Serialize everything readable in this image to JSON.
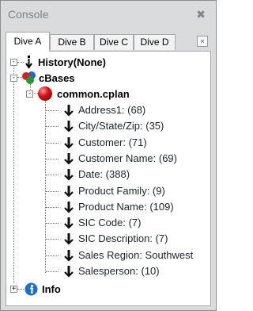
{
  "window": {
    "title": "Console",
    "close_glyph": "✖"
  },
  "tabs": [
    {
      "label": "Dive A",
      "active": true
    },
    {
      "label": "Dive B",
      "active": false
    },
    {
      "label": "Dive C",
      "active": false
    },
    {
      "label": "Dive D",
      "active": false
    }
  ],
  "tab_close_glyph": "×",
  "tree": {
    "history": {
      "label": "History(None)",
      "expander": "-"
    },
    "cbases": {
      "label": "cBases",
      "expander": "-"
    },
    "common": {
      "label": "common.cplan",
      "expander": "-"
    },
    "dimensions": [
      "Address1: (68)",
      "City/State/Zip: (35)",
      "Customer: (71)",
      "Customer Name: (69)",
      "Date: (388)",
      "Product Family: (9)",
      "Product Name: (109)",
      "SIC Code: (7)",
      "SIC Description: (7)",
      "Sales Region: Southwest",
      "Salesperson: (10)"
    ],
    "info": {
      "label": "Info",
      "expander": "+"
    }
  },
  "colors": {
    "frame_bg": "#d9dbdd",
    "panel_bg": "#ffffff",
    "ball_red": "#d41313",
    "info_blue": "#1a6fd0"
  }
}
